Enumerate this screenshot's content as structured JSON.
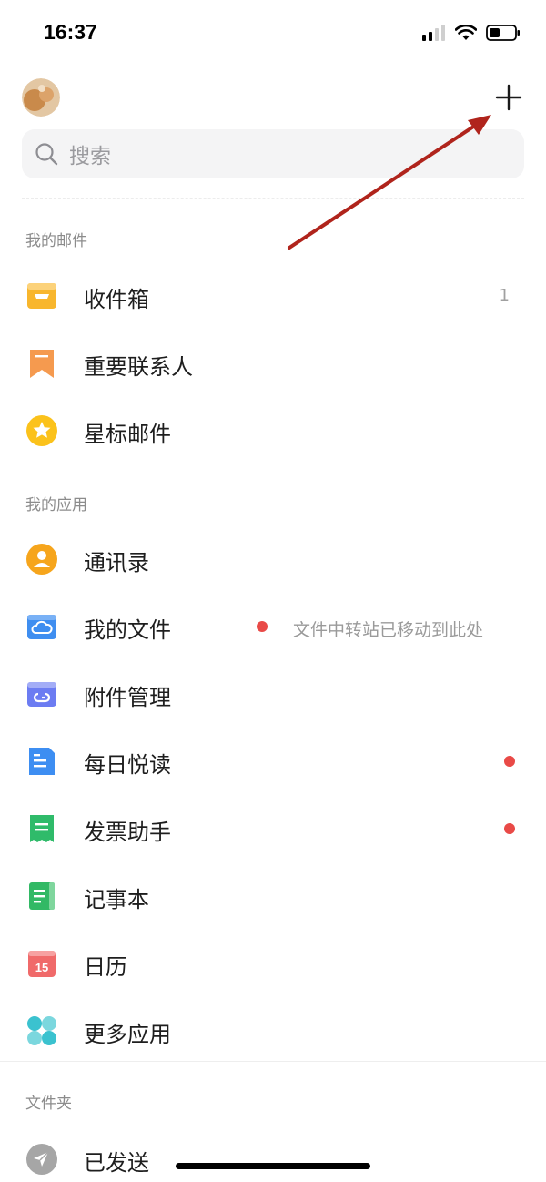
{
  "status": {
    "time": "16:37"
  },
  "search": {
    "placeholder": "搜索"
  },
  "sections": {
    "my_mail": "我的邮件",
    "my_apps": "我的应用",
    "folders": "文件夹"
  },
  "mail_items": [
    {
      "label": "收件箱",
      "count": "1"
    },
    {
      "label": "重要联系人"
    },
    {
      "label": "星标邮件"
    }
  ],
  "app_items": [
    {
      "label": "通讯录"
    },
    {
      "label": "我的文件",
      "hint": "文件中转站已移动到此处"
    },
    {
      "label": "附件管理"
    },
    {
      "label": "每日悦读"
    },
    {
      "label": "发票助手"
    },
    {
      "label": "记事本"
    },
    {
      "label": "日历",
      "icon_text": "15"
    },
    {
      "label": "更多应用"
    }
  ],
  "folder_items": [
    {
      "label": "已发送"
    }
  ],
  "colors": {
    "inbox": "#f8b62d",
    "important": "#f59a4f",
    "star": "#fbc21b",
    "contacts": "#f6a51c",
    "files": "#3f8ef0",
    "attachments": "#6c7cf2",
    "daily_read": "#3d8ef2",
    "invoice": "#2fbb6a",
    "notes": "#32b965",
    "calendar": "#f06a6a",
    "more_apps": "#3bc2cf",
    "sent": "#a6a6a6",
    "red_dot": "#e94a47",
    "annotation_arrow": "#b0241c"
  },
  "icons": {
    "inbox": "inbox-icon",
    "important": "bookmark-icon",
    "star": "star-icon",
    "contacts": "contact-person-icon",
    "files": "cloud-folder-icon",
    "attachments": "attachment-link-icon",
    "daily_read": "article-icon",
    "invoice": "receipt-icon",
    "notes": "notebook-icon",
    "calendar": "calendar-icon",
    "more_apps": "four-circles-icon",
    "sent": "paper-plane-icon",
    "add": "plus-icon",
    "search": "search-icon"
  }
}
